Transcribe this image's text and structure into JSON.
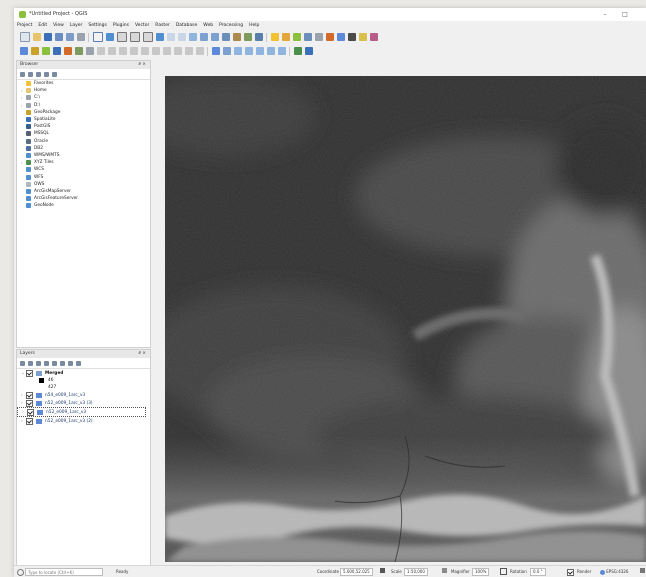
{
  "window": {
    "title": "*Untitled Project - QGIS",
    "minimize": "–",
    "maximize": "□"
  },
  "menubar": [
    "Project",
    "Edit",
    "View",
    "Layer",
    "Settings",
    "Plugins",
    "Vector",
    "Raster",
    "Database",
    "Web",
    "Processing",
    "Help"
  ],
  "browser": {
    "title": "Browser",
    "close": "∂ ×",
    "items": [
      {
        "label": "Favorites",
        "icon": "star-icon",
        "color": "#f2c233",
        "arrow": ""
      },
      {
        "label": "Home",
        "icon": "folder-icon",
        "color": "#e5c46a",
        "arrow": "›"
      },
      {
        "label": "C:\\",
        "icon": "drive-icon",
        "color": "#9aa3ad",
        "arrow": "›"
      },
      {
        "label": "D:\\",
        "icon": "drive-icon",
        "color": "#9aa3ad",
        "arrow": "›"
      },
      {
        "label": "GeoPackage",
        "icon": "geopackage-icon",
        "color": "#c9a227",
        "arrow": ""
      },
      {
        "label": "SpatiaLite",
        "icon": "spatialite-icon",
        "color": "#3b6fb8",
        "arrow": ""
      },
      {
        "label": "PostGIS",
        "icon": "postgis-icon",
        "color": "#33608f",
        "arrow": ""
      },
      {
        "label": "MSSQL",
        "icon": "mssql-icon",
        "color": "#556070",
        "arrow": ""
      },
      {
        "label": "Oracle",
        "icon": "oracle-icon",
        "color": "#5a6b85",
        "arrow": ""
      },
      {
        "label": "DB2",
        "icon": "db2-icon",
        "color": "#4d6ea0",
        "arrow": ""
      },
      {
        "label": "WMS/WMTS",
        "icon": "wms-icon",
        "color": "#4f8fcf",
        "arrow": ""
      },
      {
        "label": "XYZ Tiles",
        "icon": "xyz-tiles-icon",
        "color": "#4a8f4a",
        "arrow": "›"
      },
      {
        "label": "WCS",
        "icon": "wcs-icon",
        "color": "#4f8fcf",
        "arrow": ""
      },
      {
        "label": "WFS",
        "icon": "wfs-icon",
        "color": "#4f8fcf",
        "arrow": ""
      },
      {
        "label": "OWS",
        "icon": "ows-icon",
        "color": "#b0b8c2",
        "arrow": ""
      },
      {
        "label": "ArcGisMapServer",
        "icon": "arcgis-map-icon",
        "color": "#4f8fcf",
        "arrow": ""
      },
      {
        "label": "ArcGisFeatureServer",
        "icon": "arcgis-feature-icon",
        "color": "#4f8fcf",
        "arrow": ""
      },
      {
        "label": "GeoNode",
        "icon": "geonode-icon",
        "color": "#4f8fcf",
        "arrow": ""
      }
    ]
  },
  "layers": {
    "title": "Layers",
    "close": "∂ ×",
    "merged": {
      "name": "Merged",
      "min": "46",
      "max": "427"
    },
    "items": [
      "n54_e009_1arc_v3",
      "n52_e009_1arc_v3 (3)",
      "n52_e009_1arc_v3",
      "n52_e009_1arc_v3 (2)"
    ]
  },
  "statusbar": {
    "search_placeholder": "Type to locate (Ctrl+K)",
    "ready": "Ready",
    "coordinate_label": "Coordinate",
    "coordinate_value": "5.000,52.025",
    "scale_label": "Scale",
    "scale_value": "1:50,000",
    "magnifier_label": "Magnifier",
    "magnifier_value": "100%",
    "rotation_label": "Rotation",
    "rotation_value": "0.0 °",
    "render_label": "Render",
    "crs": "EPSG:4326"
  }
}
